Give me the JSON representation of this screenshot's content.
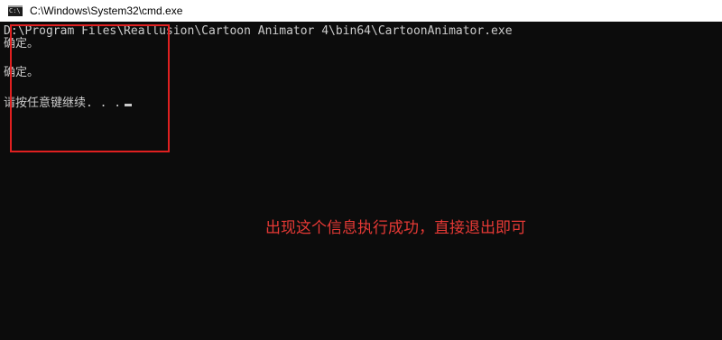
{
  "window": {
    "title": "C:\\Windows\\System32\\cmd.exe",
    "icon": "cmd-console-icon"
  },
  "console": {
    "lines": [
      "D:\\Program Files\\Reallusion\\Cartoon Animator 4\\bin64\\CartoonAnimator.exe",
      "确定。",
      "确定。",
      "请按任意键继续. . ."
    ]
  },
  "annotation": {
    "text": "出现这个信息执行成功，直接退出即可",
    "color": "#e53935"
  },
  "highlight": {
    "color": "#e02020"
  }
}
